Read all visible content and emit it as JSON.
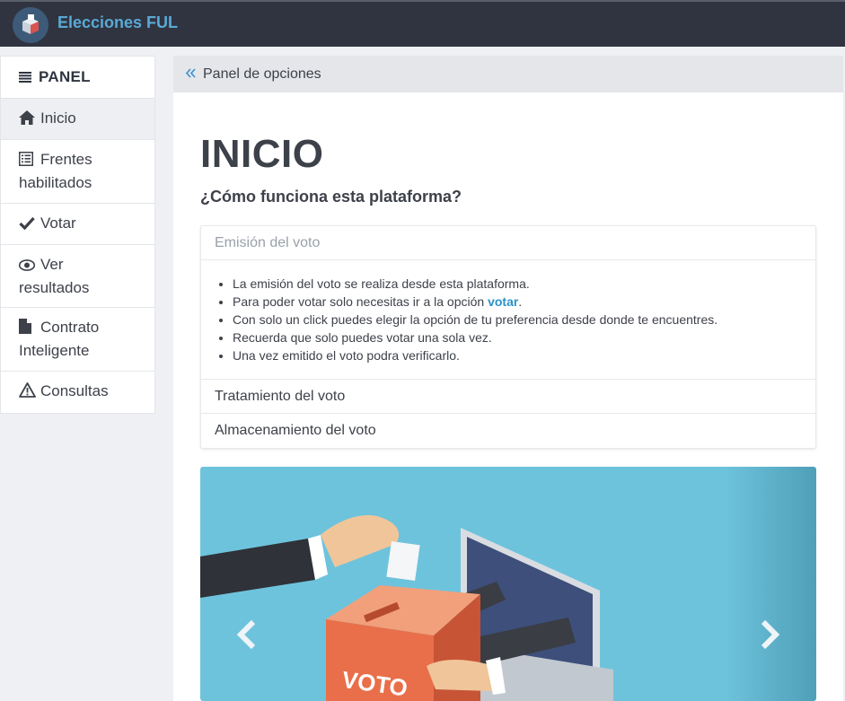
{
  "app": {
    "brand": "Elecciones FUL"
  },
  "icons": {
    "logo": "ballot-box-logo",
    "panel": "list-icon",
    "inicio": "home-icon",
    "frentes": "list-alt-icon",
    "votar": "check-icon",
    "ver": "eye-icon",
    "contrato": "file-icon",
    "consultas": "warning-icon",
    "crumb": "double-chevron-left-icon"
  },
  "sidebar": {
    "header": "PANEL",
    "items": [
      {
        "label": "Inicio"
      },
      {
        "label": "Frentes habilitados"
      },
      {
        "label": "Votar"
      },
      {
        "label": "Ver resultados"
      },
      {
        "label": "Contrato Inteligente"
      },
      {
        "label": "Consultas"
      }
    ]
  },
  "breadcrumb": {
    "label": "Panel de opciones"
  },
  "page": {
    "title": "INICIO",
    "subtitle": "¿Cómo funciona esta plataforma?"
  },
  "accordion": {
    "sections": [
      {
        "title": "Emisión del voto",
        "items": [
          "La emisión del voto se realiza desde esta plataforma.",
          "Para poder votar solo necesitas ir a la opción",
          "Con solo un click puedes elegir la opción de tu preferencia desde donde te encuentres.",
          "Recuerda que solo puedes votar una sola vez.",
          "Una vez emitido el voto podra verificarlo."
        ],
        "link_text": "votar",
        "link_suffix": "."
      },
      {
        "title": "Tratamiento del voto"
      },
      {
        "title": "Almacenamiento del voto"
      }
    ]
  },
  "carousel": {
    "ballot_label": "VOTO"
  },
  "colors": {
    "topbar": "#2f3440",
    "brand": "#5aa9d6",
    "link": "#2a92c8",
    "carousel_bg": "#6ec3dc"
  }
}
